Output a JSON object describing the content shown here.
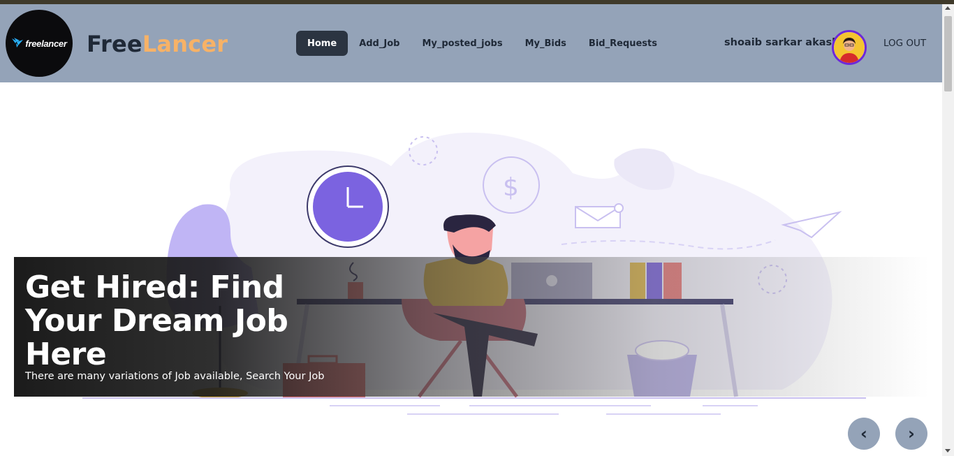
{
  "logo": {
    "text": "freelancer",
    "icon": "bird-icon"
  },
  "brand": {
    "part1": "Free",
    "part2": "Lancer"
  },
  "nav": {
    "items": [
      {
        "label": "Home",
        "active": true
      },
      {
        "label": "Add_Job",
        "active": false
      },
      {
        "label": "My_posted_jobs",
        "active": false
      },
      {
        "label": "My_Bids",
        "active": false
      },
      {
        "label": "Bid_Requests",
        "active": false
      }
    ]
  },
  "user": {
    "name": "shoaib sarkar akash",
    "logout": "LOG OUT"
  },
  "hero": {
    "title": "Get Hired: Find Your Dream Job Here",
    "subtitle": "There are many variations of Job available, Search Your Job"
  },
  "carousel": {
    "prev": "‹",
    "next": "›"
  },
  "colors": {
    "navbar": "#94a3b8",
    "accent": "#f7b267",
    "active_nav": "#2b3441",
    "avatar_ring": "#6d28d9"
  }
}
